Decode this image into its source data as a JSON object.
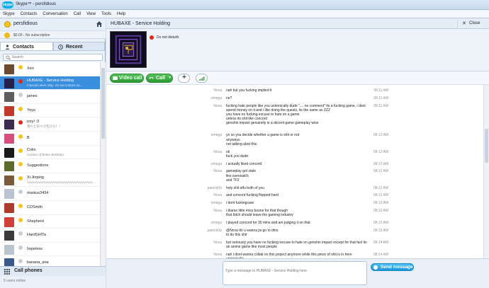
{
  "window": {
    "title": "Skype™ - persfidious",
    "app_badge": "skype"
  },
  "menu": [
    "Skype",
    "Contacts",
    "Conversation",
    "Call",
    "View",
    "Tools",
    "Help"
  ],
  "account": {
    "name": "persfidious",
    "credit": "$0.00 - No subscription"
  },
  "tabs": {
    "contacts": "Contacts",
    "recent": "Recent"
  },
  "search": {
    "placeholder": "Search"
  },
  "contacts": [
    {
      "name": "Xen",
      "mood": "",
      "status": "away",
      "avatar_color": "#6b4a2f"
    },
    {
      "name": "HUBAXE - Service Holding",
      "mood": "Internal users only.. do not contact us...",
      "status": "dnd",
      "avatar_color": "#2a1f4a"
    },
    {
      "name": "james",
      "mood": "",
      "status": "offline",
      "avatar_color": "#5e5e5e"
    },
    {
      "name": "Yoyo",
      "mood": "",
      "status": "away",
      "avatar_color": "#c0392b"
    },
    {
      "name": "izzy! :3",
      "mood": "落ちた日々が花びら！！",
      "status": "dnd",
      "avatar_color": "#3b2b4f"
    },
    {
      "name": "B",
      "mood": "",
      "status": "away",
      "avatar_color": "#d64e7a"
    },
    {
      "name": "Colin",
      "mood": "Creator of Better Bedwars.",
      "status": "away",
      "avatar_color": "#1a1a1a"
    },
    {
      "name": "Suggestions",
      "mood": "",
      "status": "away",
      "avatar_color": "#5a6b2a"
    },
    {
      "name": "Xi Jinping",
      "mood": "AAAAAAAAAAAAAAAAAAAAAAAAAAAAAAA...",
      "status": "away",
      "avatar_color": "#7a5a3a"
    },
    {
      "name": "markus3434",
      "mood": "",
      "status": "offline",
      "avatar_color": "#b9c4cf"
    },
    {
      "name": "CDSmith",
      "mood": "",
      "status": "away",
      "avatar_color": "#b03a2e"
    },
    {
      "name": "Shepherd",
      "mood": "",
      "status": "away",
      "avatar_color": "#d0403a"
    },
    {
      "name": "HardSHITa",
      "mood": "",
      "status": "offline",
      "avatar_color": "#3a3a3a"
    },
    {
      "name": "hopeless",
      "mood": "",
      "status": "offline",
      "avatar_color": "#b9c4cf"
    },
    {
      "name": "banana_ana",
      "mood": "",
      "status": "offline",
      "avatar_color": "#3a5a8a"
    }
  ],
  "status_colors": {
    "away": "#f5c518",
    "dnd": "#e2271b",
    "offline": "#c7cdd3",
    "online": "#4ab54a"
  },
  "call_phones": "Call phones",
  "users_online": "5 users online",
  "conversation": {
    "title": "HUBAXE - Service Holding",
    "close_label": "Close",
    "status_text": "Do not disturb"
  },
  "toolbar": {
    "video_call": "Video call",
    "call": "Call"
  },
  "messages": [
    {
      "sender": "Nova",
      "text": "nah but you fucking implied it",
      "time": "08:11 AM"
    },
    {
      "sender": "omega",
      "text": "no?",
      "time": "08:11 AM"
    },
    {
      "sender": "Nova",
      "text": "fucking hate people like you unironically dude \".... no comment\" its a fucking game, i dont spend money on it and i like doing the quests, its the same as ZZZ\nyou have no fucking excuse to hate on a game\nunless its shit like concord\ngenshin impact genuinely is a decent game gameplay wise",
      "time": "08:11 AM"
    },
    {
      "sender": "omega",
      "text": "yo so you decide whether a game is shit or not\nanyways\nnot talking abot this",
      "time": "08:12 AM"
    },
    {
      "sender": "Nova",
      "text": "ok\nfuck you dude",
      "time": "08:12 AM"
    },
    {
      "sender": "omega",
      "text": "i actually liked concord",
      "time": "08:12 AM"
    },
    {
      "sender": "Nova",
      "text": "gameplay got stale\nlike overwatch\nand TF2",
      "time": "08:12 AM"
    },
    {
      "sender": "patrick0p",
      "text": "holy shit stfu both of you",
      "time": "08:12 AM"
    },
    {
      "sender": "Nova",
      "text": "and concord fucking flopped hard",
      "time": "08:12 AM"
    },
    {
      "sender": "omega",
      "text": "i dont fuckingcare",
      "time": "08:13 AM"
    },
    {
      "sender": "Nova",
      "text": "i blame little miss boone for that though\nthat bitch should leave the gaming industry",
      "time": "08:13 AM"
    },
    {
      "sender": "omega",
      "text": "i played concord for 30 mins and am judging it on that",
      "time": "08:13 AM"
    },
    {
      "sender": "patrick0p",
      "text": "@Nova do u wanna jis go to dms\nto do this shit",
      "time": "08:13 AM"
    },
    {
      "sender": "Nova",
      "text": "but seriously you have no fucking excuse to hate on genshin impact except for that fact its an anime game like most people",
      "time": "08:14 AM"
    },
    {
      "sender": "Nova",
      "text": "nah i dont wanna collab on this project anymore while this piece of shit is in here unironically.",
      "time": "08:14 AM"
    },
    {
      "sender": "omega",
      "text": "bro i just said no comment on genshin impact....",
      "time": "08:15 AM"
    }
  ],
  "compose": {
    "placeholder": "Type a message to HUBAXE - Service Holding here",
    "send_label": "Send message"
  }
}
